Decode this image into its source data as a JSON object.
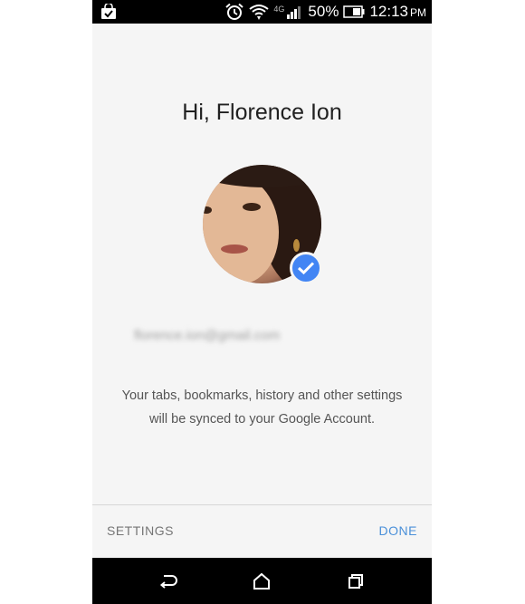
{
  "status_bar": {
    "left_icon": "shopping-bag-check-icon",
    "icons": [
      "alarm-icon",
      "wifi-icon",
      "cell-signal-icon",
      "battery-icon"
    ],
    "network_type": "4G",
    "battery_percent": "50%",
    "battery_level": 0.5,
    "time": "12:13",
    "ampm": "PM"
  },
  "signin": {
    "greeting": "Hi, Florence Ion",
    "avatar_icon": "profile-photo",
    "badge_icon": "checkmark-icon",
    "email": "florence.ion@gmail.com",
    "description_line1": "Your tabs, bookmarks, history and other settings",
    "description_line2": "will be synced to your Google Account."
  },
  "footer": {
    "settings_label": "SETTINGS",
    "done_label": "DONE"
  },
  "nav_bar": {
    "icons": [
      "back-icon",
      "home-icon",
      "recents-icon"
    ]
  },
  "colors": {
    "accent": "#4285f4",
    "done": "#4a90d9",
    "background": "#f5f5f5",
    "status_bar": "#000000"
  }
}
